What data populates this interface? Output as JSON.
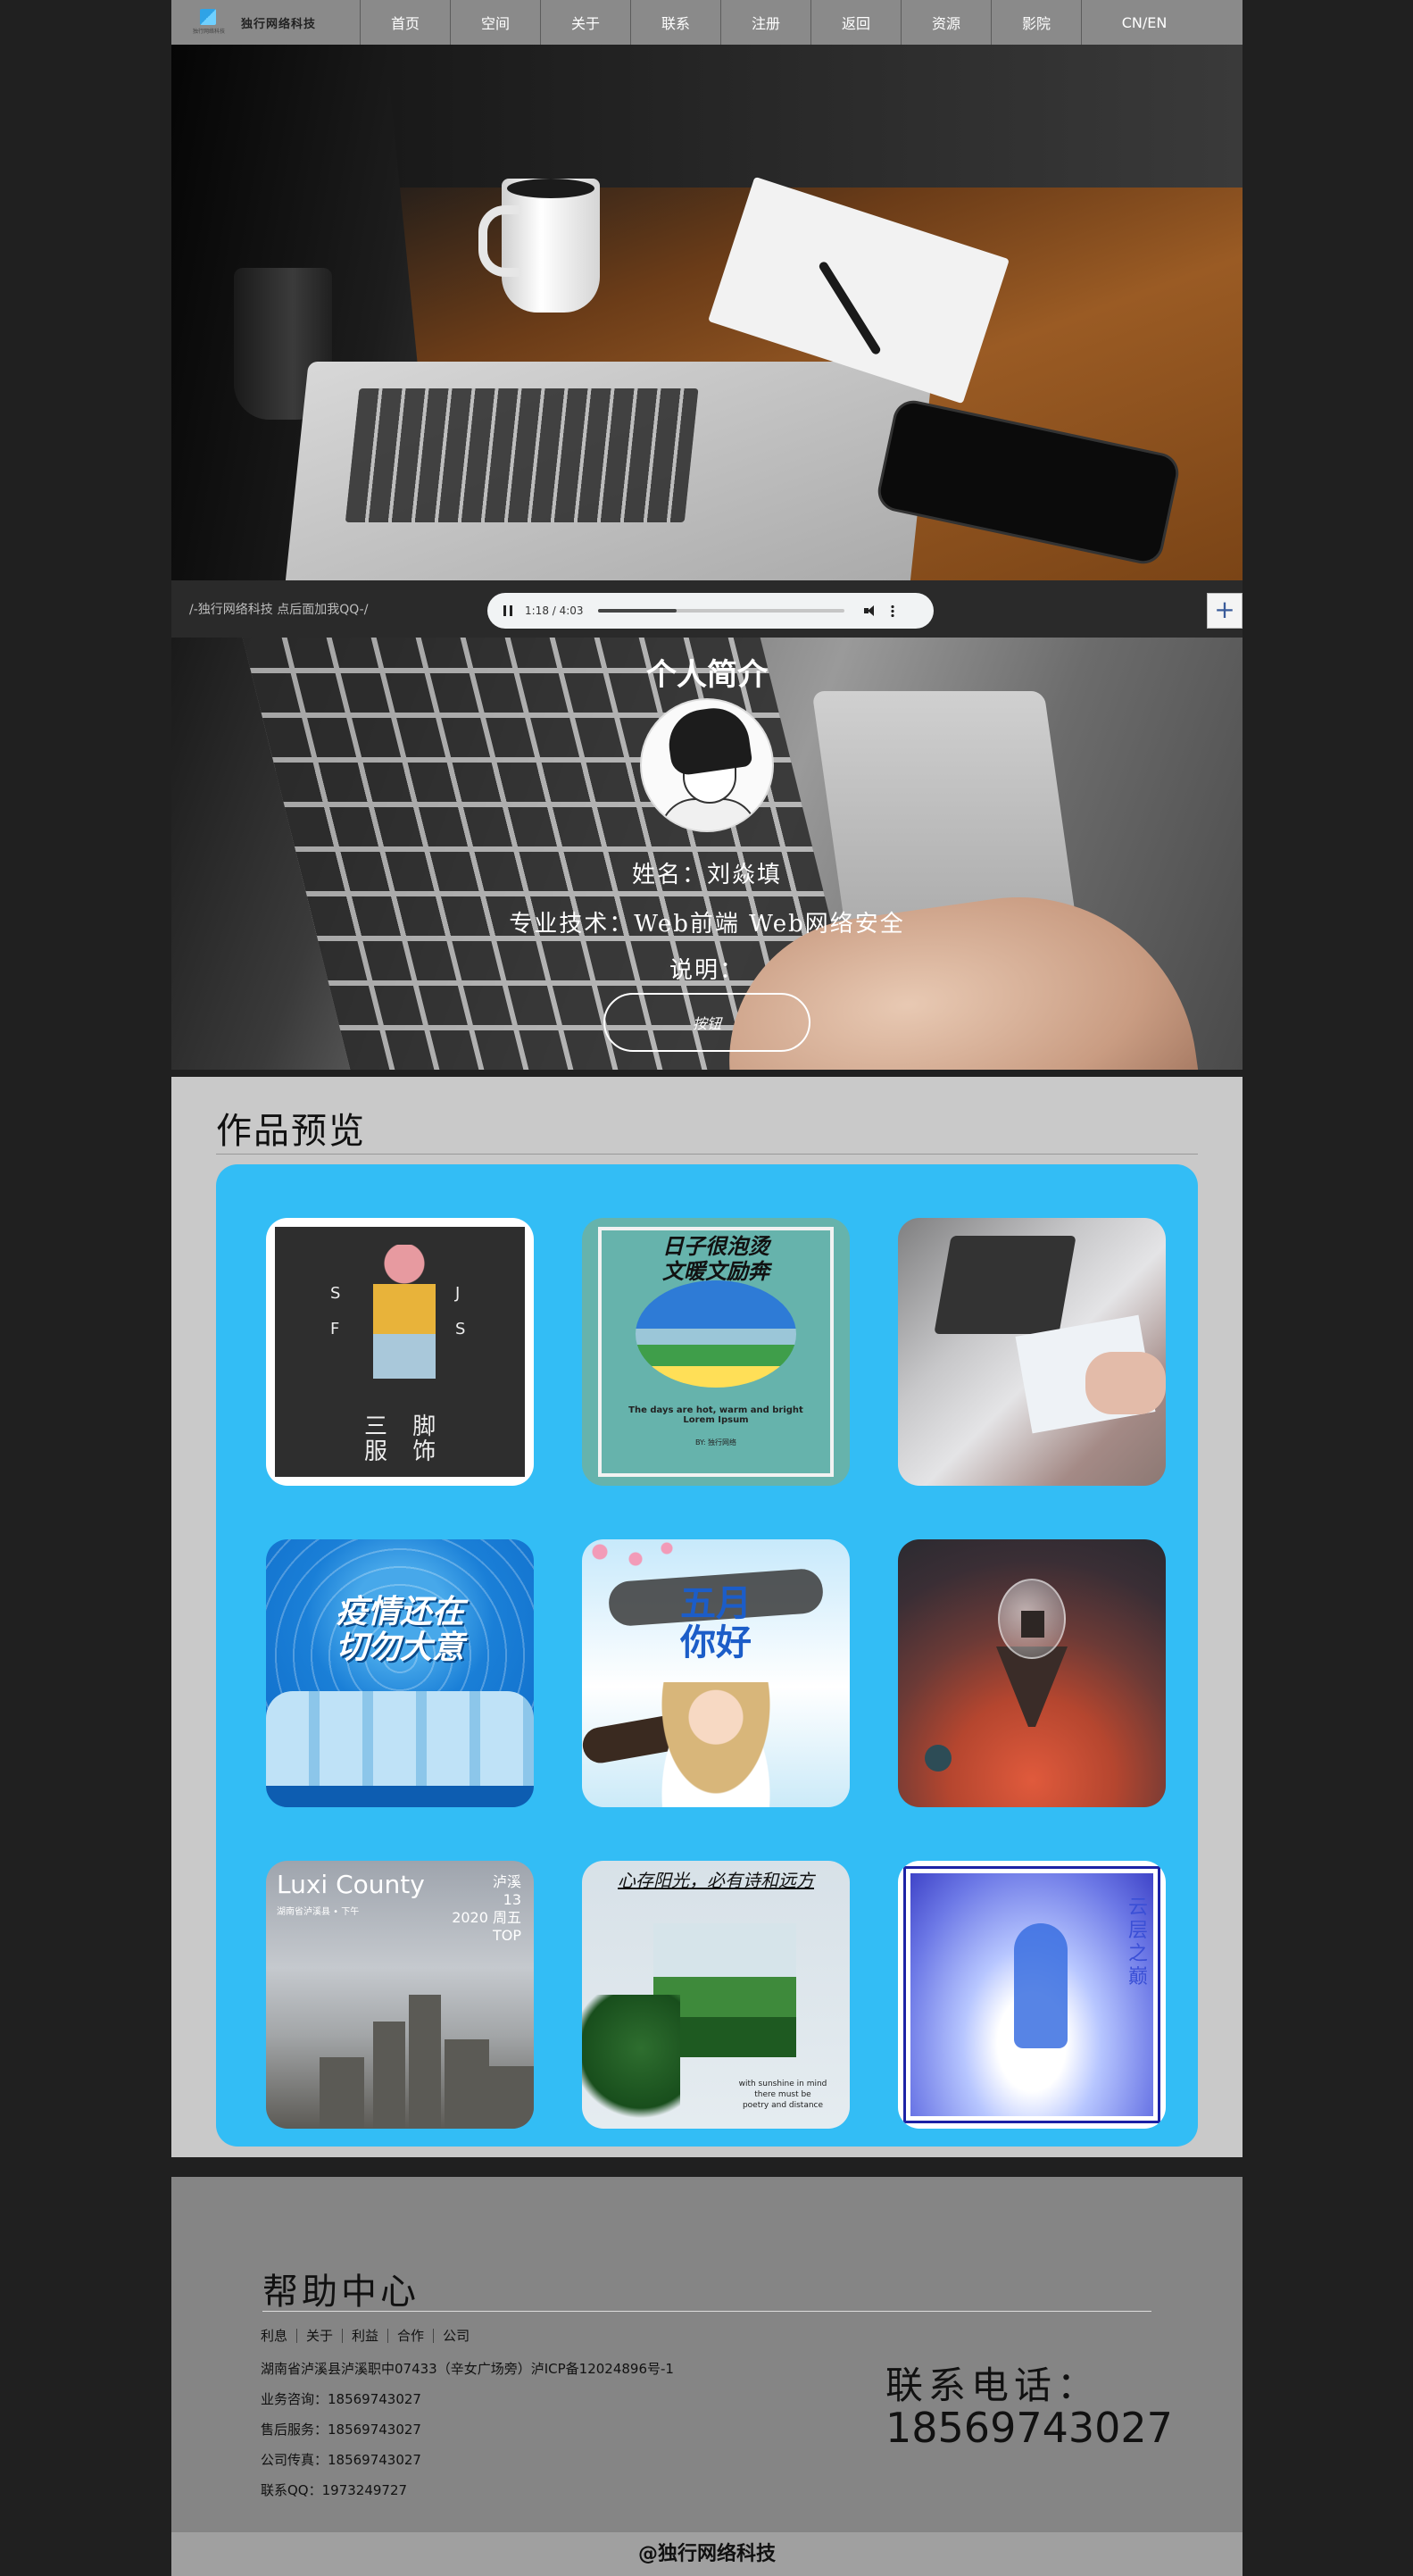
{
  "nav": {
    "brand_name": "独行网络科技",
    "items": [
      "首页",
      "空间",
      "关于",
      "联系",
      "注册",
      "返回",
      "资源",
      "影院"
    ],
    "lang": "CN/EN"
  },
  "strip": {
    "text": "/-独行网络科技 点后面加我QQ-/",
    "player_time": "1:18 / 4:03",
    "player_progress": 0.32,
    "plus": "+"
  },
  "profile": {
    "title": "个人简介",
    "name": "姓名：刘焱填",
    "skills": "专业技术：Web前端 Web网络安全",
    "desc": "说明：",
    "button": "按钮"
  },
  "works": {
    "title": "作品预览",
    "t1": {
      "letters": [
        "S",
        "J",
        "F",
        "S"
      ],
      "big": "三 脚\n服 饰"
    },
    "t2": {
      "head": "日子很泡烫\n文暖文励奔",
      "sub": "The days are hot, warm and bright\nLorem Ipsum",
      "sub2": "BY: 独行网络"
    },
    "t4": {
      "title": "疫情还在\n切勿大意"
    },
    "t5": {
      "title": "五月\n你好"
    },
    "t7": {
      "title": "Luxi County",
      "addr": "湖南省泸溪县 • 下午",
      "date": "泸溪\n13\n2020 周五\nTOP"
    },
    "t8": {
      "title": "心存阳光，必有诗和远方",
      "txt": "with sunshine in mind\nthere must be\npoetry and distance"
    },
    "t9": {
      "vtxt": "云层之巅"
    }
  },
  "footer": {
    "help_title": "帮助中心",
    "links": [
      "利息",
      "关于",
      "利益",
      "合作",
      "公司"
    ],
    "address": "湖南省泸溪县泸溪职中07433（辛女广场旁）泸ICP备12024896号-1",
    "business": "业务咨询：18569743027",
    "after_sales": "售后服务：18569743027",
    "fax": "公司传真：18569743027",
    "qq": "联系QQ：1973249727",
    "phone_label": "联系电话：",
    "phone_number": "18569743027",
    "copyright": "@独行网络科技"
  }
}
